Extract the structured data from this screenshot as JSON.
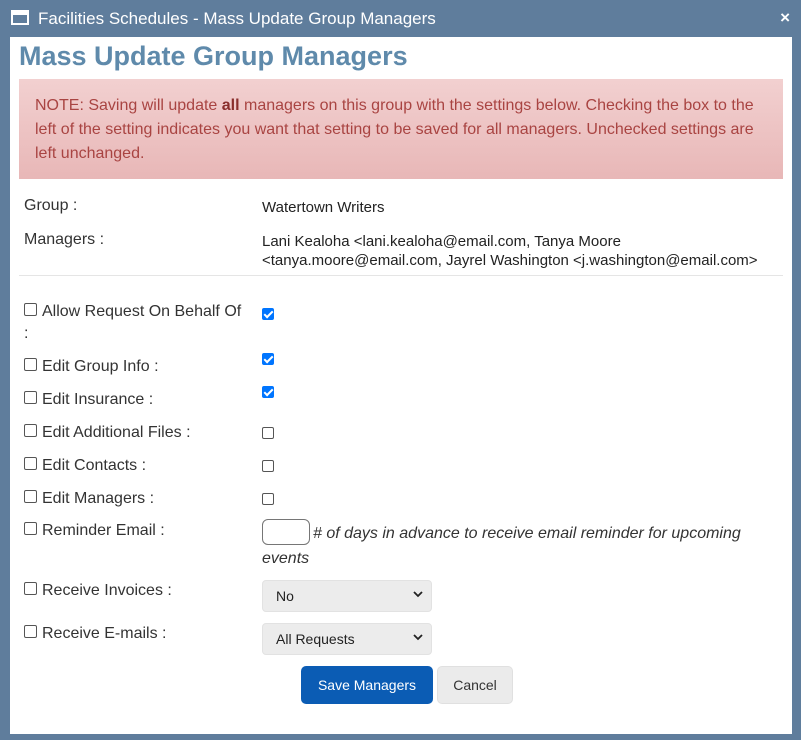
{
  "window": {
    "title": "Facilities Schedules - Mass Update Group Managers",
    "close_label": "×"
  },
  "page": {
    "heading": "Mass Update Group Managers"
  },
  "note": {
    "prefix": "NOTE: Saving will update ",
    "bold": "all",
    "suffix": " managers on this group with the settings below. Checking the box to the left of the setting indicates you want that setting to be saved for all managers. Unchecked settings are left unchanged."
  },
  "info": {
    "group_label": "Group :",
    "group_value": "Watertown Writers",
    "managers_label": "Managers :",
    "managers_value": "Lani Kealoha <lani.kealoha@email.com, Tanya Moore <tanya.moore@email.com, Jayrel Washington <j.washington@email.com>"
  },
  "settings": [
    {
      "label": "Allow Request On Behalf Of :",
      "include": false,
      "value": true
    },
    {
      "label": "Edit Group Info :",
      "include": false,
      "value": true
    },
    {
      "label": "Edit Insurance :",
      "include": false,
      "value": true
    },
    {
      "label": "Edit Additional Files :",
      "include": false,
      "value": false
    },
    {
      "label": "Edit Contacts :",
      "include": false,
      "value": false
    },
    {
      "label": "Edit Managers :",
      "include": false,
      "value": false
    }
  ],
  "reminder": {
    "label": "Reminder Email :",
    "include": false,
    "value": "",
    "note": "# of days in advance to receive email reminder for upcoming events"
  },
  "invoices": {
    "label": "Receive Invoices :",
    "include": false,
    "selected": "No"
  },
  "emails": {
    "label": "Receive E-mails :",
    "include": false,
    "selected": "All Requests"
  },
  "buttons": {
    "save": "Save Managers",
    "cancel": "Cancel"
  },
  "colors": {
    "titlebar": "#5f7d9c",
    "heading": "#5f8aab",
    "note_bg": "#f2d0d0",
    "note_text": "#a94442",
    "primary": "#0b5cb4",
    "checkbox_on": "#0075ff"
  }
}
